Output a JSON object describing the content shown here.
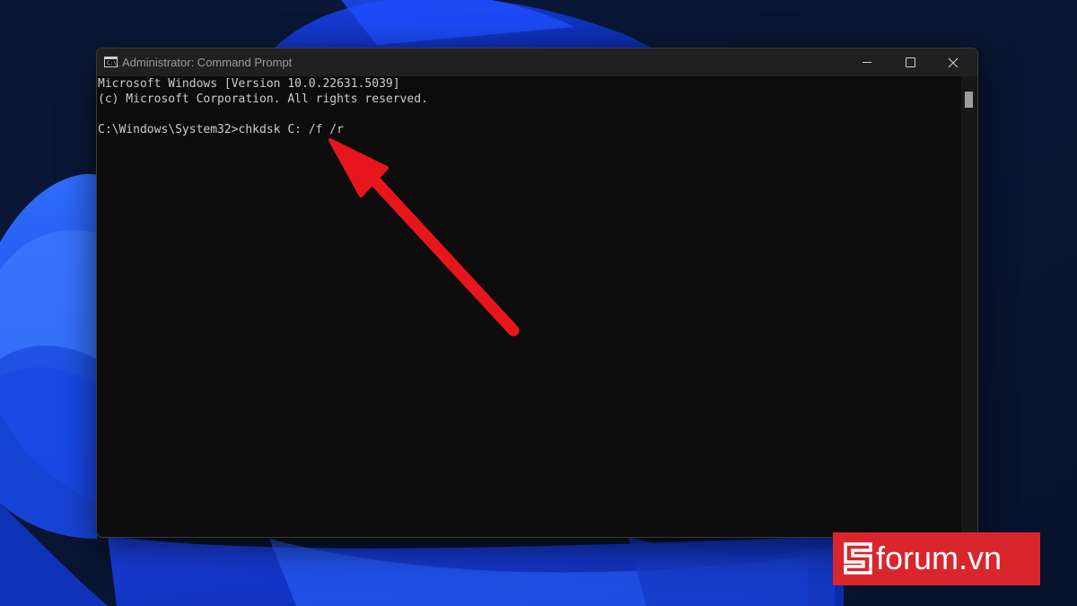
{
  "window": {
    "title": "Administrator: Command Prompt",
    "icon": "cmd-icon",
    "icon_glyph": "C:\\_"
  },
  "controls": {
    "minimize_icon": "minimize-icon",
    "maximize_icon": "maximize-icon",
    "close_icon": "close-icon",
    "close_glyph": "✕"
  },
  "console": {
    "lines": [
      "Microsoft Windows [Version 10.0.22631.5039]",
      "(c) Microsoft Corporation. All rights reserved.",
      "",
      "C:\\Windows\\System32>chkdsk C: /f /r"
    ]
  },
  "annotation": {
    "arrow_color": "#e8161c"
  },
  "watermark": {
    "text": "forum.vn",
    "brand_color": "#d9262c"
  }
}
